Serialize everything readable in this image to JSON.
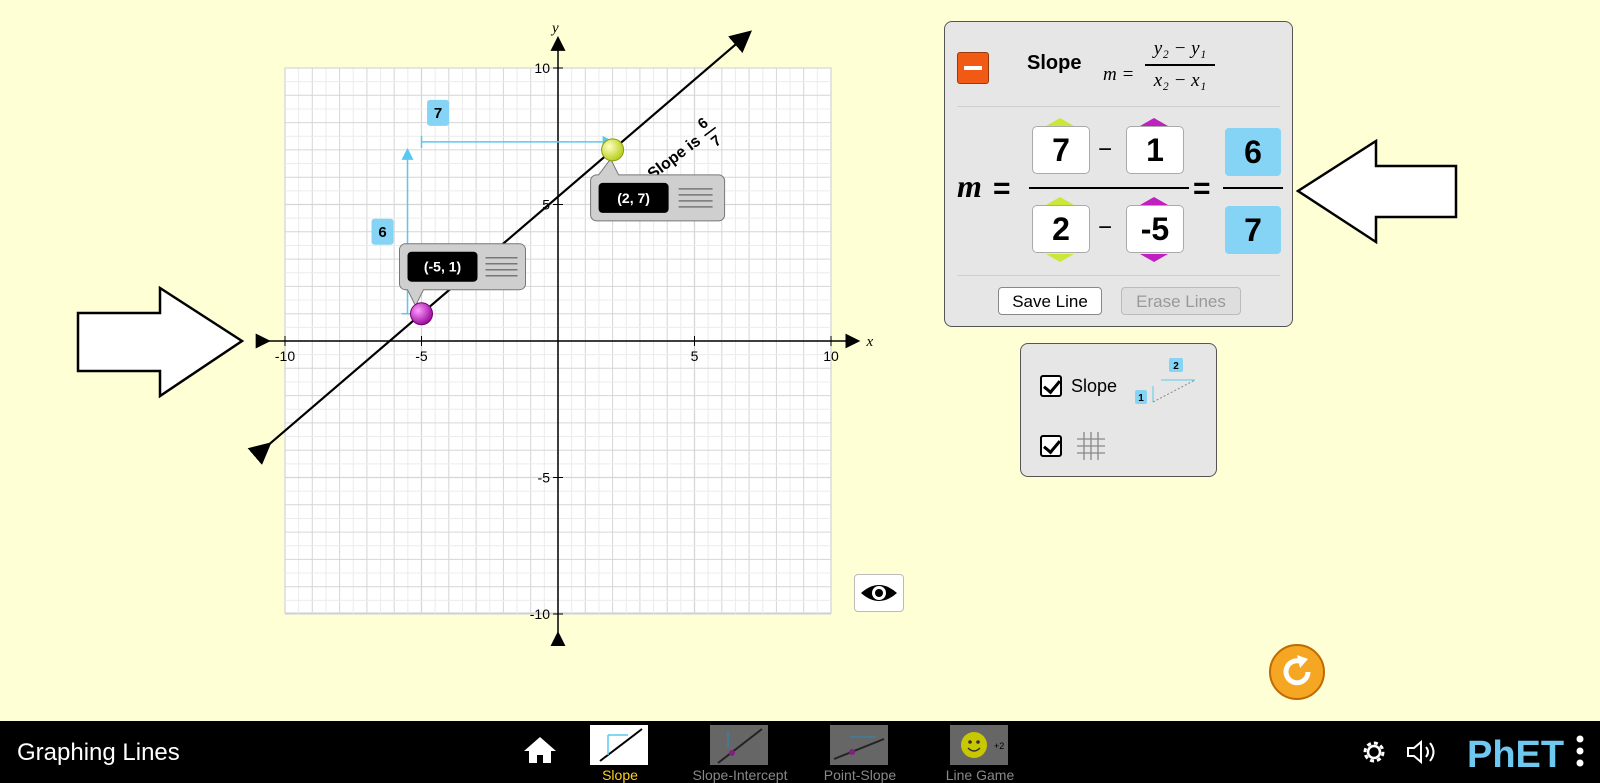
{
  "graph": {
    "x_axis_label": "x",
    "y_axis_label": "y",
    "x_tick_labels": [
      "-10",
      "-5",
      "5",
      "10"
    ],
    "y_tick_labels": [
      "10",
      "5",
      "-5",
      "-10"
    ],
    "x_range": [
      -10,
      10
    ],
    "y_range": [
      -10,
      10
    ],
    "grid": true,
    "point1": {
      "x": -5,
      "y": 1,
      "label": "(-5, 1)",
      "color": "#c020c0"
    },
    "point2": {
      "x": 2,
      "y": 7,
      "label": "(2, 7)",
      "color": "#d8f040"
    },
    "rise_label": "6",
    "run_label": "7",
    "slope_text": "Slope is",
    "slope_num": "6",
    "slope_den": "7",
    "line_color": "#000000",
    "bracket_color": "#5ac8f0"
  },
  "equation_panel": {
    "title": "Slope",
    "formula": {
      "lhs": "m =",
      "num": "y₂ − y₁",
      "den": "x₂ − x₁"
    },
    "m_label": "m",
    "equals": "=",
    "minus": "−",
    "y2": "7",
    "y1": "1",
    "x2": "2",
    "x1": "-5",
    "result_num": "6",
    "result_den": "7",
    "save_label": "Save Line",
    "erase_label": "Erase Lines",
    "accent_color": "#f05a14",
    "result_color": "#86d4f5"
  },
  "options_panel": {
    "slope_label": "Slope",
    "slope_checked": true,
    "grid_checked": true,
    "icon_rise": "1",
    "icon_run": "2"
  },
  "navbar": {
    "title": "Graphing Lines",
    "screens": [
      {
        "label": "Slope",
        "active": true
      },
      {
        "label": "Slope-Intercept",
        "active": false
      },
      {
        "label": "Point-Slope",
        "active": false
      },
      {
        "label": "Line Game",
        "active": false
      }
    ],
    "game_badge": "+2",
    "logo": "PhET"
  }
}
